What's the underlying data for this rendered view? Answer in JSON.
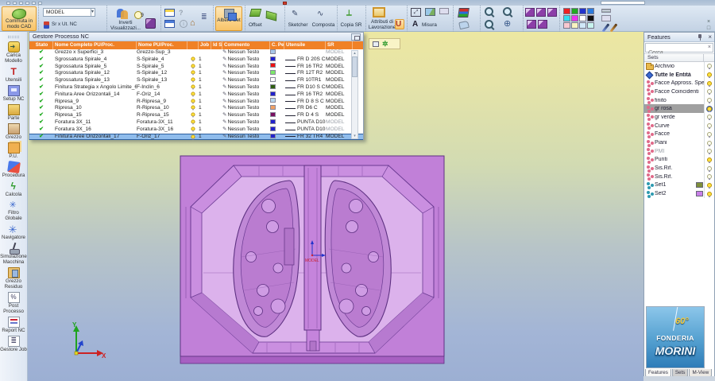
{
  "window": {
    "close": "×",
    "restore": "□",
    "minimize": "—"
  },
  "toolbar": {
    "commuta": "Commuta in\nmodo CAD",
    "combo_value": "MODEL",
    "sr_ut": "Sr x Ut. NC",
    "inverti": "Inverti\nVisualizzazi...",
    "albero_set": "Albero Set",
    "offset": "Offset",
    "sketcher": "Sketcher",
    "composta": "Composta",
    "copia_sr": "Copia SR",
    "attributi": "Attributi di\nLavorazione",
    "misura": "Misura",
    "palette": [
      {
        "c": "#ee2222"
      },
      {
        "c": "#22aa22"
      },
      {
        "c": "#2233cc"
      },
      {
        "c": "#2b7bde"
      },
      {
        "c": "#33ddee"
      },
      {
        "c": "#ee33ee"
      },
      {
        "c": "#ffffff"
      },
      {
        "c": "#111111"
      },
      {
        "c": "#f8c8d0"
      },
      {
        "c": "#f8f4c0"
      },
      {
        "c": "#d0e8f8"
      },
      {
        "c": "#c8f4ee"
      }
    ]
  },
  "sidebar": {
    "items": [
      {
        "label": "Carica\nModello",
        "icon": "load-model-icon"
      },
      {
        "label": "Utensili",
        "icon": "tools-icon"
      },
      {
        "label": "Setup NC",
        "icon": "setup-nc-icon"
      },
      {
        "label": "Parte",
        "icon": "part-icon"
      },
      {
        "label": "Grezzo",
        "icon": "stock-icon"
      },
      {
        "label": "P.U.",
        "icon": "pu-icon"
      },
      {
        "label": "Procedura",
        "icon": "procedure-icon"
      },
      {
        "label": "Calcola",
        "icon": "calculate-icon"
      },
      {
        "label": "Filtro\nGlobale",
        "icon": "global-filter-icon"
      },
      {
        "label": "Navigatore",
        "icon": "navigator-icon"
      },
      {
        "label": "Simulazione\nMacchina",
        "icon": "machine-sim-icon"
      },
      {
        "label": "Grezzo\nResiduo",
        "icon": "residual-stock-icon"
      },
      {
        "label": "Post\nProcesso",
        "icon": "post-process-icon"
      },
      {
        "label": "Report NC",
        "icon": "report-nc-icon"
      },
      {
        "label": "Gestore Job",
        "icon": "job-manager-icon"
      }
    ]
  },
  "process_panel": {
    "title": "Gestore Processo NC",
    "columns": [
      "Stato",
      "Nome Completo PU/Proc.",
      "Nome PU/Proc.",
      "",
      "Job N.",
      "Id S",
      "Commento",
      "C. Penna",
      "Utensile",
      "SR"
    ],
    "rows": [
      {
        "nome": "Grezzo x Superfici_3",
        "short": "Grezzo-Sup_3",
        "job": "",
        "commento": "Nessun Testo",
        "color": "#a9c7e8",
        "tool": "",
        "sr": "MODEL",
        "sr_dim": true,
        "nobulb": true
      },
      {
        "nome": "Sgrossatura Spirale_4",
        "short": "S-Spirale_4",
        "job": "1",
        "commento": "Nessun Testo",
        "color": "#2222cc",
        "tool": "FR D 20S C",
        "sr": "MODEL"
      },
      {
        "nome": "Sgrossatura Spirale_5",
        "short": "S-Spirale_5",
        "job": "1",
        "commento": "Nessun Testo",
        "color": "#ee1111",
        "tool": "FR 16 TR2",
        "sr": "MODEL"
      },
      {
        "nome": "Sgrossatura Spirale_12",
        "short": "S-Spirale_12",
        "job": "1",
        "commento": "Nessun Testo",
        "color": "#7ce86a",
        "tool": "FR 12T R2",
        "sr": "MODEL"
      },
      {
        "nome": "Sgrossatura Spirale_13",
        "short": "S-Spirale_13",
        "job": "1",
        "commento": "Nessun Testo",
        "color": "#ffffff",
        "tool": "FR 10TR1",
        "sr": "MODEL"
      },
      {
        "nome": "Finitura Strategia x Angolo Limite_6",
        "short": "F-Inclin_6",
        "job": "1",
        "commento": "Nessun Testo",
        "color": "#2f5e12",
        "tool": "FR D10 S C",
        "sr": "MODEL"
      },
      {
        "nome": "Finitura Aree Orizzontali_14",
        "short": "F-Oriz_14",
        "job": "1",
        "commento": "Nessun Testo",
        "color": "#2222cc",
        "tool": "FR 16 TR2",
        "sr": "MODEL"
      },
      {
        "nome": "Ripresa_9",
        "short": "R-Ripresa_9",
        "job": "1",
        "commento": "Nessun Testo",
        "color": "#b8d8f0",
        "tool": "FR D 8 S C",
        "sr": "MODEL"
      },
      {
        "nome": "Ripresa_10",
        "short": "R-Ripresa_10",
        "job": "1",
        "commento": "Nessun Testo",
        "color": "#f0a064",
        "tool": "FR D6 C",
        "sr": "MODEL"
      },
      {
        "nome": "Ripresa_15",
        "short": "R-Ripresa_15",
        "job": "1",
        "commento": "Nessun Testo",
        "color": "#7a1060",
        "tool": "FR D 4 S",
        "sr": "MODEL"
      },
      {
        "nome": "Foratura 3X_11",
        "short": "Foratura-3X_11",
        "job": "1",
        "commento": "Nessun Testo",
        "color": "#2222cc",
        "tool": "PUNTA D10",
        "sr": "MODEL",
        "sr_dim": true
      },
      {
        "nome": "Foratura 3X_16",
        "short": "Foratura-3X_16",
        "job": "1",
        "commento": "Nessun Testo",
        "color": "#2222cc",
        "tool": "PUNTA D10",
        "sr": "MODEL",
        "sr_dim": true
      },
      {
        "nome": "Finitura Aree Orizzontali_17",
        "short": "F-Oriz_17",
        "job": "1",
        "commento": "Nessun Testo",
        "color": "#2222cc",
        "tool": "FR 32 TR4",
        "sr": "MODEL",
        "selected": true
      }
    ]
  },
  "features_panel": {
    "title": "Features",
    "search_placeholder": "Cerca",
    "column_header": "Sets",
    "items": [
      {
        "label": "Archivio",
        "icon": "archive-folder-icon"
      },
      {
        "label": "Tutte le Entità",
        "icon": "all-entities-icon",
        "bold": true,
        "on": true
      },
      {
        "label": "Facce Appross. Specia...",
        "icon": "feature-set-icon",
        "on": true
      },
      {
        "label": "Facce Coincidenti",
        "icon": "feature-set-icon"
      },
      {
        "label": "finito",
        "icon": "feature-set-icon"
      },
      {
        "label": "gr rosa",
        "icon": "feature-set-icon",
        "selected": true,
        "on": true
      },
      {
        "label": "gr verde",
        "icon": "feature-set-icon"
      },
      {
        "label": "Curve",
        "icon": "feature-set-icon"
      },
      {
        "label": "Facce",
        "icon": "feature-set-icon"
      },
      {
        "label": "Piani",
        "icon": "feature-set-icon"
      },
      {
        "label": "PMI",
        "icon": "feature-set-icon",
        "dim": true
      },
      {
        "label": "Punti",
        "icon": "feature-set-icon",
        "on": true
      },
      {
        "label": "Sis.Rif.",
        "icon": "feature-set-icon"
      },
      {
        "label": "Sis.Rif.",
        "icon": "feature-set-icon"
      },
      {
        "label": "Set1",
        "icon": "user-set-icon",
        "swatch": "#7e8f3a",
        "on": true
      },
      {
        "label": "Set2",
        "icon": "user-set-icon",
        "swatch": "#c97fe8",
        "on": true
      }
    ],
    "tabs": [
      {
        "label": "Features",
        "active": true
      },
      {
        "label": "Sets",
        "pressed": true
      },
      {
        "label": "M-View"
      }
    ]
  },
  "viewport": {
    "ucs_label": "MODEL",
    "axis_x": "X",
    "axis_y": "Y"
  },
  "logo": {
    "line1": "60°",
    "line2": "FONDERIA",
    "line3": "MORINI"
  },
  "colors": {
    "header_orange": "#f08126",
    "active_button": "#f8c468",
    "selected_row": "#8fbcec",
    "model_purple": "#c180d8",
    "viewport_top": "#ece7a2",
    "viewport_bottom": "#9cafd3"
  }
}
